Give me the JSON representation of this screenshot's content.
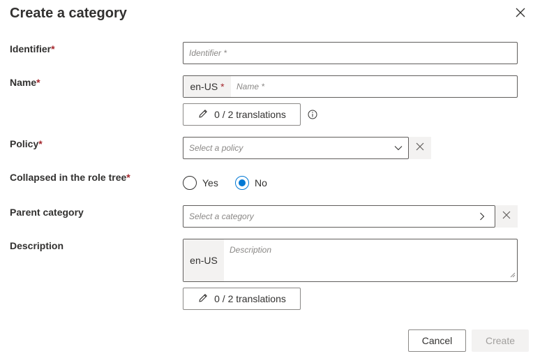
{
  "dialog": {
    "title": "Create a category",
    "close_icon": "close-icon"
  },
  "fields": {
    "identifier": {
      "label": "Identifier",
      "required_mark": "*",
      "placeholder": "Identifier *"
    },
    "name": {
      "label": "Name",
      "required_mark": "*",
      "lang_prefix": "en-US",
      "lang_required_mark": "*",
      "placeholder": "Name *",
      "translations_label": "0 / 2 translations",
      "info_icon": "info-icon",
      "edit_icon": "pencil-icon"
    },
    "policy": {
      "label": "Policy",
      "required_mark": "*",
      "placeholder": "Select a policy",
      "dropdown_icon": "chevron-down-icon",
      "clear_icon": "close-icon"
    },
    "collapsed": {
      "label": "Collapsed in the role tree",
      "required_mark": "*",
      "options": [
        "Yes",
        "No"
      ],
      "selected": "No"
    },
    "parent_category": {
      "label": "Parent category",
      "placeholder": "Select a category",
      "open_icon": "chevron-right-icon",
      "clear_icon": "close-icon"
    },
    "description": {
      "label": "Description",
      "lang_prefix": "en-US",
      "placeholder": "Description",
      "translations_label": "0 / 2 translations",
      "edit_icon": "pencil-icon"
    }
  },
  "footer": {
    "cancel_label": "Cancel",
    "create_label": "Create"
  },
  "colors": {
    "accent": "#0078d4",
    "required": "#a4262c",
    "disabled_bg": "#f3f2f1",
    "disabled_text": "#a19f9d"
  }
}
